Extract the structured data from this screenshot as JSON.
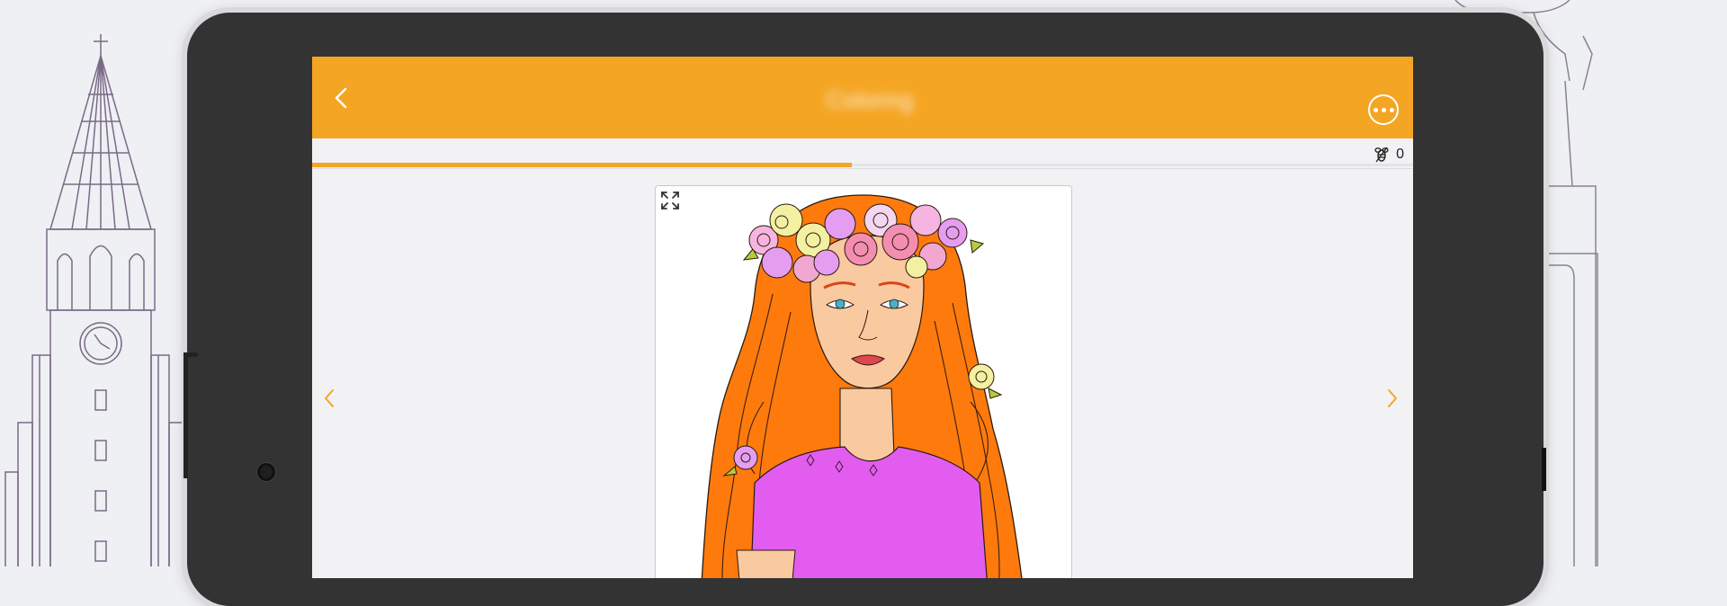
{
  "app": {
    "title": "Coloring",
    "back_icon": "chevron-left-icon",
    "menu_icon": "more-options-icon"
  },
  "toolbar": {
    "counter_icon": "bee-icon",
    "counter_value": "0"
  },
  "progress": {
    "fraction": 0.49
  },
  "artwork": {
    "subject": "girl-with-flower-crown",
    "expand_icon": "fullscreen-expand-icon",
    "prev_icon": "chevron-left-icon",
    "next_icon": "chevron-right-icon"
  },
  "colors": {
    "accent": "#f4a523",
    "hair": "#ff7a0d",
    "dress": "#e35cf0",
    "skin": "#f9c9a0",
    "lips": "#e0464d",
    "bezel": "#333333"
  }
}
